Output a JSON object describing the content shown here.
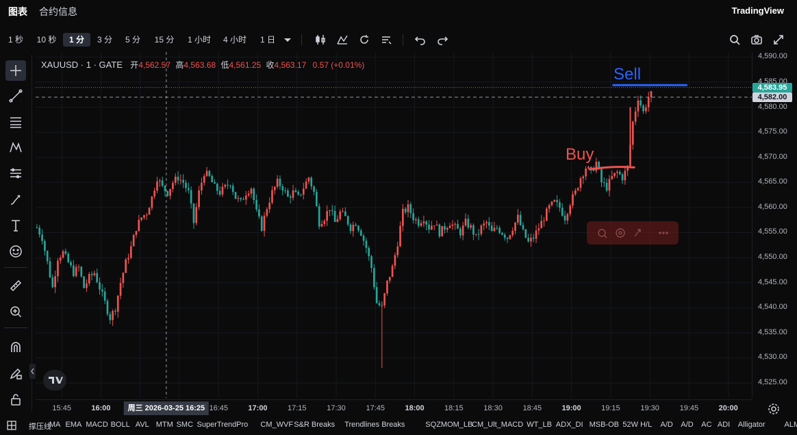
{
  "topbar": {
    "tabs": [
      "图表",
      "合约信息"
    ],
    "brand": "TradingView"
  },
  "toolbar": {
    "intervals": [
      "1 秒",
      "10 秒",
      "1 分",
      "3 分",
      "5 分",
      "15 分",
      "1 小时",
      "4 小时",
      "1 日"
    ],
    "active_interval": "1 分",
    "icons": [
      "candles-icon",
      "indicators-icon",
      "replay-icon",
      "alerts-icon",
      "undo-icon",
      "redo-icon",
      "search-icon",
      "camera-icon",
      "fullscreen-icon"
    ]
  },
  "left_tools": [
    "crosshair-icon",
    "trendline-icon",
    "fib-icon",
    "pattern-icon",
    "forecast-icon",
    "brush-icon",
    "text-icon",
    "emoji-icon",
    "ruler-icon",
    "zoom-icon",
    "magnet-icon",
    "lock-drawing-icon",
    "lock-icon"
  ],
  "legend": {
    "symbol": "XAUUSD · 1 · GATE",
    "open_label": "开",
    "open": "4,562.57",
    "high_label": "高",
    "high": "4,563.68",
    "low_label": "低",
    "low": "4,561.25",
    "close_label": "收",
    "close": "4,563.17",
    "change": "0.57 (+0.01%)"
  },
  "annotations": {
    "buy": "Buy",
    "sell": "Sell"
  },
  "price_badges": {
    "last": "4,583.95",
    "crosshair": "4,582.00"
  },
  "colors": {
    "up": "#ef5350",
    "down": "#26a69a",
    "last_badge": "#26a69a",
    "sell_line": "#2962ff",
    "buy_line": "#ef5350"
  },
  "time_axis": {
    "labels": [
      "15:45",
      "16:00",
      "16:15",
      "16:30",
      "16:45",
      "17:00",
      "17:15",
      "17:30",
      "17:45",
      "18:00",
      "18:15",
      "18:30",
      "18:45",
      "19:00",
      "19:15",
      "19:30",
      "19:45",
      "20:00"
    ],
    "bold": [
      "16:00",
      "17:00",
      "18:00",
      "19:00",
      "20:00"
    ],
    "hover_label": "周三 2026-03-25   16:25"
  },
  "indicators": [
    "撑压线",
    "MA",
    "EMA",
    "MACD",
    "BOLL",
    "AVL",
    "MTM",
    "SMC",
    "SuperTrendPro",
    "CM_WVF",
    "S&R Breaks",
    "Trendlines Breaks",
    "SQZMOM_LB",
    "CM_Ult_MACD",
    "WT_LB",
    "ADX_DI",
    "MSB-OB",
    "52W H/L",
    "A/D",
    "A/D",
    "AC",
    "ADI",
    "Alligator",
    "ALMA"
  ],
  "chart_data": {
    "type": "candlestick",
    "symbol": "XAUUSD",
    "timeframe": "1",
    "ylim": [
      4522,
      4591
    ],
    "yticks": [
      4525,
      4530,
      4535,
      4540,
      4545,
      4550,
      4555,
      4560,
      4565,
      4570,
      4575,
      4580,
      4585,
      4590
    ],
    "xlim": [
      "15:35",
      "20:09"
    ],
    "horizontal_lines": {
      "dotted": 4583.95,
      "dashed": 4582.0
    },
    "crosshair_time": "16:25",
    "path": [
      [
        "15:35",
        4556
      ],
      [
        "15:37",
        4554
      ],
      [
        "15:39",
        4549
      ],
      [
        "15:41",
        4544
      ],
      [
        "15:43",
        4550
      ],
      [
        "15:45",
        4551
      ],
      [
        "15:47",
        4549
      ],
      [
        "15:49",
        4547
      ],
      [
        "15:51",
        4548
      ],
      [
        "15:53",
        4544
      ],
      [
        "15:55",
        4546
      ],
      [
        "15:57",
        4547
      ],
      [
        "15:59",
        4544
      ],
      [
        "16:01",
        4541
      ],
      [
        "16:03",
        4538
      ],
      [
        "16:05",
        4540
      ],
      [
        "16:07",
        4545
      ],
      [
        "16:09",
        4549
      ],
      [
        "16:11",
        4552
      ],
      [
        "16:13",
        4556
      ],
      [
        "16:15",
        4558
      ],
      [
        "16:17",
        4559
      ],
      [
        "16:19",
        4562
      ],
      [
        "16:21",
        4566
      ],
      [
        "16:23",
        4564
      ],
      [
        "16:25",
        4563
      ],
      [
        "16:27",
        4565
      ],
      [
        "16:29",
        4566
      ],
      [
        "16:31",
        4565
      ],
      [
        "16:33",
        4563
      ],
      [
        "16:35",
        4557
      ],
      [
        "16:37",
        4563
      ],
      [
        "16:39",
        4567
      ],
      [
        "16:41",
        4566
      ],
      [
        "16:43",
        4564
      ],
      [
        "16:45",
        4563
      ],
      [
        "16:47",
        4564
      ],
      [
        "16:49",
        4565
      ],
      [
        "16:51",
        4562
      ],
      [
        "16:53",
        4561
      ],
      [
        "16:55",
        4563
      ],
      [
        "16:57",
        4564
      ],
      [
        "16:59",
        4559
      ],
      [
        "17:01",
        4556
      ],
      [
        "17:03",
        4560
      ],
      [
        "17:05",
        4563
      ],
      [
        "17:07",
        4565
      ],
      [
        "17:09",
        4564
      ],
      [
        "17:11",
        4562
      ],
      [
        "17:13",
        4563
      ],
      [
        "17:15",
        4562
      ],
      [
        "17:17",
        4564
      ],
      [
        "17:19",
        4566
      ],
      [
        "17:21",
        4563
      ],
      [
        "17:23",
        4557
      ],
      [
        "17:25",
        4558
      ],
      [
        "17:27",
        4560
      ],
      [
        "17:29",
        4557
      ],
      [
        "17:31",
        4559
      ],
      [
        "17:33",
        4558
      ],
      [
        "17:35",
        4556
      ],
      [
        "17:37",
        4557
      ],
      [
        "17:39",
        4555
      ],
      [
        "17:41",
        4552
      ],
      [
        "17:43",
        4548
      ],
      [
        "17:45",
        4541
      ],
      [
        "17:47",
        4540
      ],
      [
        "17:49",
        4545
      ],
      [
        "17:51",
        4548
      ],
      [
        "17:53",
        4553
      ],
      [
        "17:55",
        4559
      ],
      [
        "17:57",
        4560
      ],
      [
        "17:59",
        4558
      ],
      [
        "18:01",
        4557
      ],
      [
        "18:03",
        4558
      ],
      [
        "18:05",
        4556
      ],
      [
        "18:07",
        4557
      ],
      [
        "18:09",
        4555
      ],
      [
        "18:11",
        4556
      ],
      [
        "18:13",
        4557
      ],
      [
        "18:15",
        4556
      ],
      [
        "18:17",
        4555
      ],
      [
        "18:19",
        4557
      ],
      [
        "18:21",
        4556
      ],
      [
        "18:23",
        4554
      ],
      [
        "18:25",
        4556
      ],
      [
        "18:27",
        4557
      ],
      [
        "18:29",
        4555
      ],
      [
        "18:31",
        4556
      ],
      [
        "18:33",
        4555
      ],
      [
        "18:35",
        4554
      ],
      [
        "18:37",
        4556
      ],
      [
        "18:39",
        4558
      ],
      [
        "18:41",
        4555
      ],
      [
        "18:43",
        4553
      ],
      [
        "18:45",
        4554
      ],
      [
        "18:47",
        4556
      ],
      [
        "18:49",
        4558
      ],
      [
        "18:51",
        4560
      ],
      [
        "18:53",
        4561
      ],
      [
        "18:55",
        4560
      ],
      [
        "18:57",
        4558
      ],
      [
        "18:59",
        4561
      ],
      [
        "19:01",
        4563
      ],
      [
        "19:03",
        4566
      ],
      [
        "19:05",
        4568
      ],
      [
        "19:07",
        4567
      ],
      [
        "19:09",
        4569
      ],
      [
        "19:11",
        4565
      ],
      [
        "19:13",
        4564
      ],
      [
        "19:15",
        4566
      ],
      [
        "19:17",
        4567
      ],
      [
        "19:19",
        4566
      ],
      [
        "19:21",
        4568
      ],
      [
        "19:23",
        4577
      ],
      [
        "19:25",
        4582
      ],
      [
        "19:27",
        4579
      ],
      [
        "19:29",
        4582
      ],
      [
        "19:31",
        4583
      ]
    ]
  }
}
